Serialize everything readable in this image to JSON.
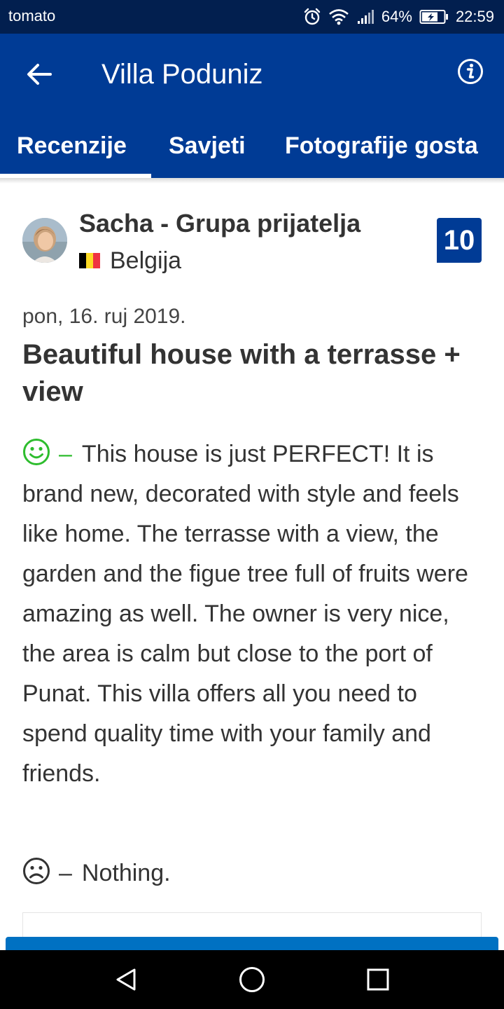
{
  "status_bar": {
    "carrier": "tomato",
    "battery": "64%",
    "time": "22:59",
    "icons": [
      "alarm-icon",
      "wifi-icon",
      "signal-icon",
      "battery-icon"
    ]
  },
  "header": {
    "title": "Villa Poduniz",
    "back_icon": "arrow-left-icon",
    "info_icon": "info-icon",
    "colors": {
      "brand": "#003b95",
      "status": "#021f4f"
    }
  },
  "tabs": [
    {
      "label": "Recenzije",
      "active": true
    },
    {
      "label": "Savjeti",
      "active": false
    },
    {
      "label": "Fotografije gosta",
      "active": false
    }
  ],
  "review": {
    "reviewer": "Sacha - Grupa prijatelja",
    "country": "Belgija",
    "score": "10",
    "date": "pon, 16. ruj 2019.",
    "title": "Beautiful house with a terrasse + view",
    "positive_dash": "–",
    "positive": "This house is just PERFECT! It is brand new, decorated with style and feels like home. The terrasse with a view, the garden and the figue tree full of fruits were amazing as well. The owner is very nice, the area is calm but close to the port of Punat. This villa offers all you need to spend quality time with your family and friends.",
    "negative_dash": "–",
    "negative": "Nothing.",
    "colors": {
      "positive": "#2ebd2e",
      "score_bg": "#003b95"
    }
  },
  "nav_bar": {
    "icons": [
      "nav-back-icon",
      "nav-home-icon",
      "nav-recents-icon"
    ]
  }
}
